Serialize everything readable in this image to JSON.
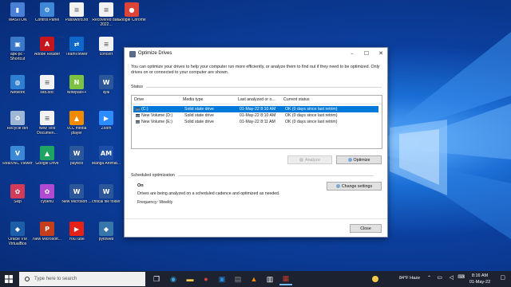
{
  "desktop_icons": [
    {
      "label": "WASITON",
      "color": "#4a7fd6",
      "glyph": "▮"
    },
    {
      "label": "Control Panel",
      "color": "#3f88d8",
      "glyph": "⚙"
    },
    {
      "label": "Password.txt",
      "color": "#f2f2f2",
      "glyph": "≡"
    },
    {
      "label": "Recovered data 2022...",
      "color": "#f2f2f2",
      "glyph": "≡"
    },
    {
      "label": "Google Chrome",
      "color": "#db4437",
      "glyph": "●"
    },
    {
      "label": "apk-pc - Shortcut",
      "color": "#3a78c8",
      "glyph": "▣"
    },
    {
      "label": "Adobe Reader",
      "color": "#c4161c",
      "glyph": "A"
    },
    {
      "label": "TeamViewer",
      "color": "#0e68c9",
      "glyph": "⇄"
    },
    {
      "label": "concert",
      "color": "#f2f2f2",
      "glyph": "≡"
    },
    {
      "label": "Network",
      "color": "#2f7fd0",
      "glyph": "◍"
    },
    {
      "label": "ssd.doc",
      "color": "#f2f2f2",
      "glyph": "≡"
    },
    {
      "label": "Notepad++",
      "color": "#7cc142",
      "glyph": "N"
    },
    {
      "label": "ilyal",
      "color": "#2b579a",
      "glyph": "W"
    },
    {
      "label": "Recycle Bin",
      "color": "#9fb7d6",
      "glyph": "♻"
    },
    {
      "label": "New Text Documen...",
      "color": "#f2f2f2",
      "glyph": "≡"
    },
    {
      "label": "VLC media player",
      "color": "#f08a00",
      "glyph": "▲"
    },
    {
      "label": "Zoom",
      "color": "#2d8cff",
      "glyph": "▶"
    },
    {
      "label": "RealVNC Viewer",
      "color": "#3b88d6",
      "glyph": "V"
    },
    {
      "label": "Google Drive",
      "color": "#1fa463",
      "glyph": "▲"
    },
    {
      "label": "paytest",
      "color": "#2b579a",
      "glyph": "W"
    },
    {
      "label": "Manga Animat...",
      "color": "#1e4fa8",
      "glyph": "AM"
    },
    {
      "label": "Skip",
      "color": "#d33b5a",
      "glyph": "✿"
    },
    {
      "label": "cyberlu",
      "color": "#b04bd1",
      "glyph": "✿"
    },
    {
      "label": "New Microsoft ...",
      "color": "#2b579a",
      "glyph": "W"
    },
    {
      "label": "critical file folder",
      "color": "#2b579a",
      "glyph": "W"
    },
    {
      "label": "Oracle VM VirtualBox",
      "color": "#1c5ea8",
      "glyph": "◆"
    },
    {
      "label": "New Microsoft...",
      "color": "#c43e1c",
      "glyph": "P"
    },
    {
      "label": "YouTube",
      "color": "#e62117",
      "glyph": "▶"
    },
    {
      "label": "pytoweb",
      "color": "#3776ab",
      "glyph": "◆"
    }
  ],
  "dialog": {
    "title": "Optimize Drives",
    "intro": "You can optimize your drives to help your computer run more efficiently, or analyze them to find out if they need to be optimized. Only drives on or connected to your computer are shown.",
    "status_label": "Status",
    "columns": [
      "Drive",
      "Media type",
      "Last analyzed or o...",
      "Current status"
    ],
    "rows": [
      {
        "drive": "(C:)",
        "media": "Solid state drive",
        "last": "01-May-22 8:10 AM",
        "status": "OK (0 days since last retrim)",
        "selected": true
      },
      {
        "drive": "New Volume (D:)",
        "media": "Solid state drive",
        "last": "01-May-22 8:10 AM",
        "status": "OK (0 days since last retrim)",
        "selected": false
      },
      {
        "drive": "New Volume (E:)",
        "media": "Solid state drive",
        "last": "01-May-22 8:11 AM",
        "status": "OK (0 days since last retrim)",
        "selected": false
      }
    ],
    "analyze_label": "Analyze",
    "optimize_label": "Optimize",
    "scheduled_label": "Scheduled optimization",
    "sched_state": "On",
    "sched_desc": "Drives are being analyzed on a scheduled cadence and optimized as needed.",
    "frequency": "Frequency: Weekly",
    "change_settings_label": "Change settings",
    "close_label": "Close"
  },
  "taskbar": {
    "search_placeholder": "Type here to search",
    "weather": "84°F  Haze",
    "time": "8:16 AM",
    "date": "01-May-22"
  },
  "colors": {
    "accent": "#0078d7",
    "taskbar": "#1c2230"
  }
}
